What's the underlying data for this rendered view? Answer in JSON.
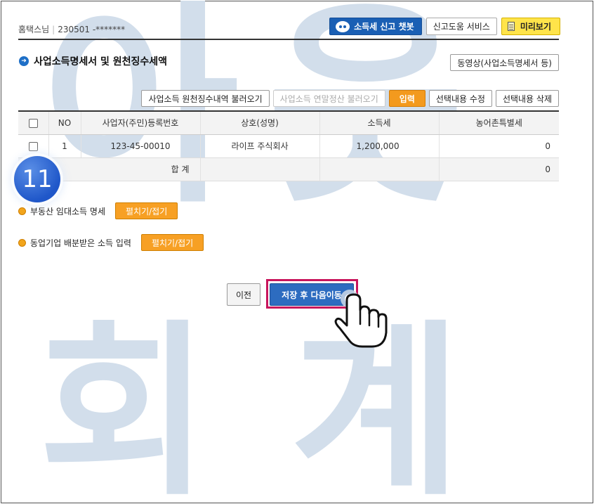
{
  "header": {
    "user_name": "홈택스님",
    "user_id": "230501 -*******",
    "buttons": {
      "chatbot": "소득세 신고 챗봇",
      "help_service": "신고도움 서비스",
      "preview": "미리보기"
    }
  },
  "section": {
    "title": "사업소득명세서 및 원천징수세액",
    "video_button": "동영상(사업소득명세서 등)"
  },
  "toolbar": {
    "load_withholding": "사업소득 원천징수내역 불러오기",
    "load_year_end": "사업소득 연말정산 불러오기",
    "input": "입력",
    "edit_selected": "선택내용 수정",
    "delete_selected": "선택내용 삭제"
  },
  "table": {
    "headers": [
      "NO",
      "사업자(주민)등록번호",
      "상호(성명)",
      "소득세",
      "농어촌특별세"
    ],
    "rows": [
      {
        "no": "1",
        "reg_no": "123-45-00010",
        "name": "라이프 주식회사",
        "income_tax": "1,200,000",
        "rural_tax": "0"
      }
    ],
    "total": {
      "label": "합 계",
      "rural_tax": "0"
    }
  },
  "step_badge": "11",
  "folds": [
    {
      "label": "부동산 임대소득 명세",
      "button": "펼치기/접기"
    },
    {
      "label": "동업기업 배분받은 소득 입력",
      "button": "펼치기/접기"
    }
  ],
  "footer": {
    "prev": "이전",
    "save_next": "저장 후 다음이동"
  },
  "watermark": {
    "line1": "아웃",
    "line2": "회계"
  },
  "colors": {
    "primary_blue": "#1a5fb4",
    "orange": "#f39a1e",
    "highlight": "#c8155c",
    "watermark": "#d2deeb"
  }
}
